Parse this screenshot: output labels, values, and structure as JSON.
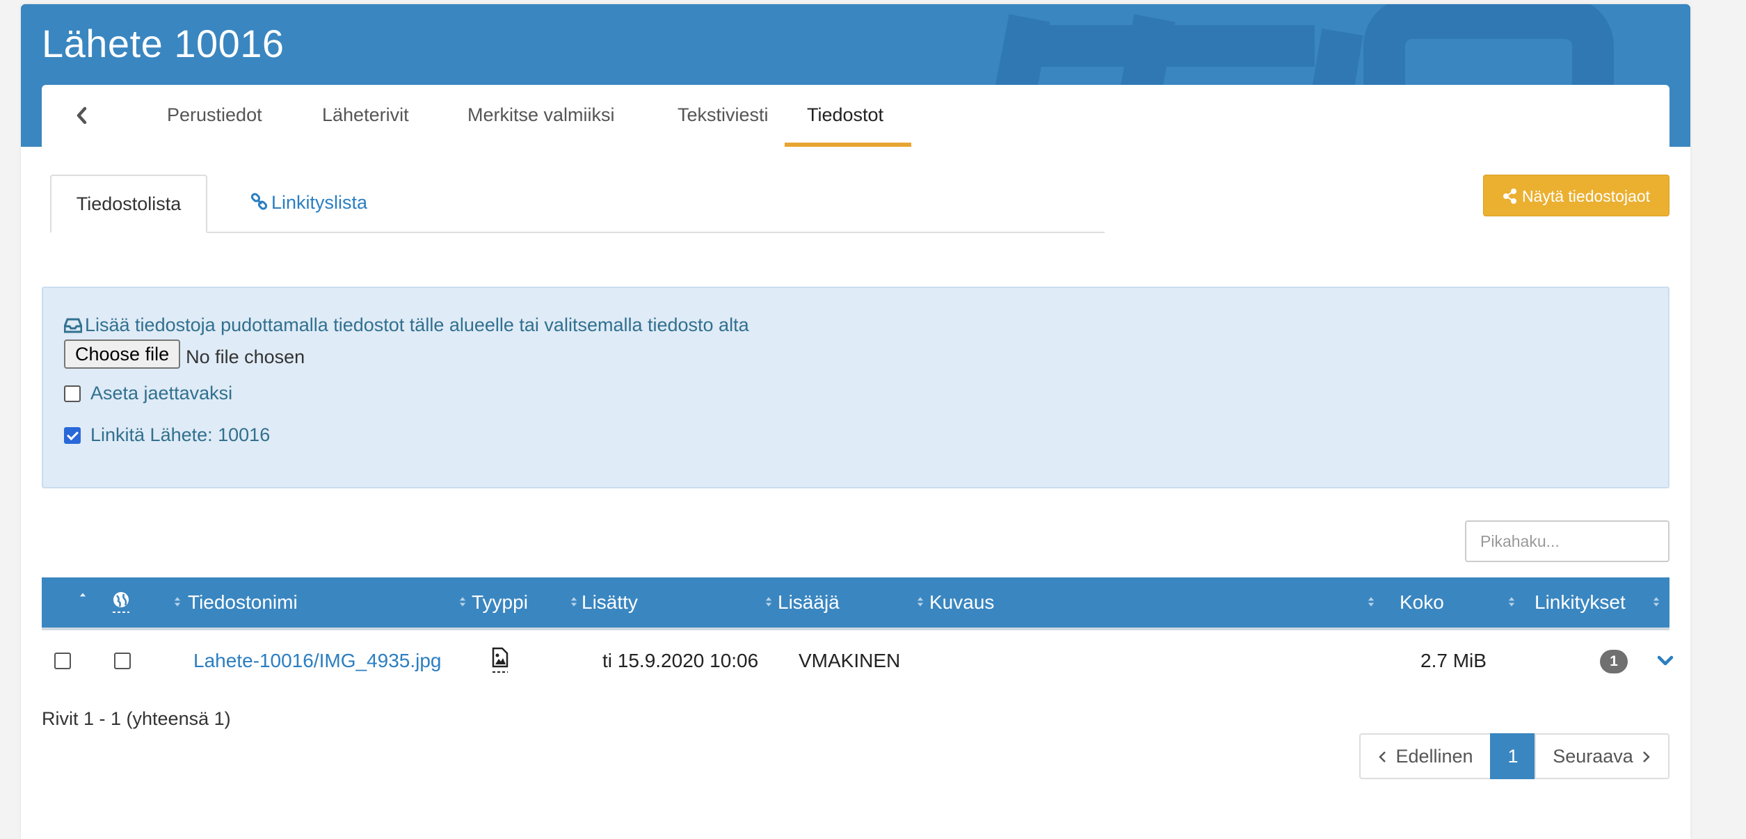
{
  "header": {
    "title": "Lähete 10016"
  },
  "tabs": [
    {
      "label": "Perustiedot"
    },
    {
      "label": "Läheterivit"
    },
    {
      "label": "Merkitse valmiiksi"
    },
    {
      "label": "Tekstiviesti"
    },
    {
      "label": "Tiedostot",
      "active": true
    }
  ],
  "subtabs": {
    "file_list": "Tiedostolista",
    "link_list": "Linkityslista"
  },
  "share_button": {
    "label": "Näytä tiedostojaot"
  },
  "upload": {
    "hint": "Lisää tiedostoja pudottamalla tiedostot tälle alueelle tai valitsemalla tiedosto alta",
    "choose_file": "Choose file",
    "file_status": "No file chosen",
    "share_checkbox": {
      "label": "Aseta jaettavaksi",
      "checked": false
    },
    "link_checkbox": {
      "label": "Linkitä Lähete: 10016",
      "checked": true
    }
  },
  "search": {
    "placeholder": "Pikahaku..."
  },
  "table": {
    "columns": {
      "name": "Tiedostonimi",
      "type": "Tyyppi",
      "added": "Lisätty",
      "adder": "Lisääjä",
      "description": "Kuvaus",
      "size": "Koko",
      "links": "Linkitykset"
    },
    "rows": [
      {
        "name": "Lahete-10016/IMG_4935.jpg",
        "type_icon": "image-file-icon",
        "added": "ti 15.9.2020 10:06",
        "adder": "VMAKINEN",
        "description": "",
        "size": "2.7 MiB",
        "links": "1"
      }
    ]
  },
  "footer": {
    "rows_info": "Rivit 1 - 1 (yhteensä 1)"
  },
  "pagination": {
    "prev": "Edellinen",
    "current": "1",
    "next": "Seuraava"
  },
  "colors": {
    "primary": "#3a86c0",
    "accent": "#e8a532",
    "info_bg": "#dfebf6",
    "link": "#2b7ec1"
  }
}
